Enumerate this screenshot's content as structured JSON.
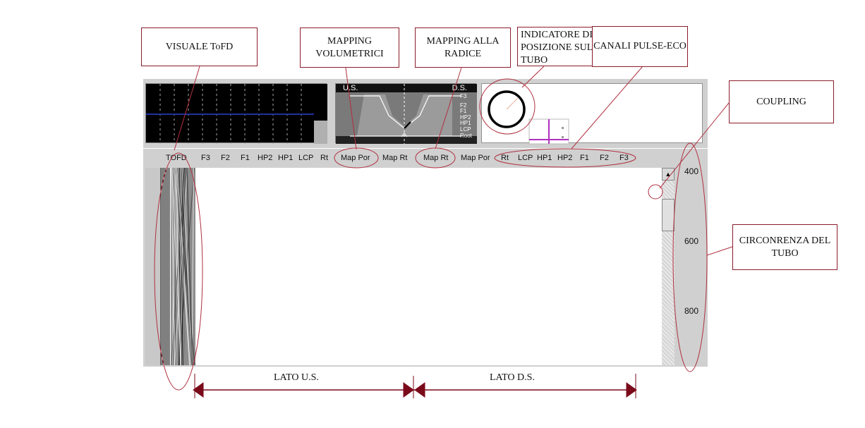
{
  "callouts": {
    "tofd_view": "VISUALE  ToFD",
    "volumetric_mapping": "MAPPING VOLUMETRICI",
    "root_mapping": "MAPPING  ALLA RADICE",
    "position_indicator": "INDICATORE DI POSIZIONE SUL TUBO",
    "pulse_echo_channels": "CANALI PULSE-ECO",
    "coupling": "COUPLING",
    "pipe_circumference": "CIRCONRENZA DEL  TUBO"
  },
  "weld_section": {
    "us_label": "U.S.",
    "ds_label": "D.S.",
    "zones": [
      "F3",
      "F2",
      "F1",
      "HP2",
      "HP1",
      "LCP",
      "Root"
    ]
  },
  "channel_headers": {
    "tofd": "TOFD",
    "us_channels": [
      "F3",
      "F2",
      "F1",
      "HP2",
      "HP1",
      "LCP",
      "Rt"
    ],
    "maps": [
      "Map Por",
      "Map Rt",
      "Map Rt",
      "Map Por"
    ],
    "ds_channels": [
      "Rt",
      "LCP",
      "HP1",
      "HP2",
      "F1",
      "F2",
      "F3"
    ]
  },
  "scale": {
    "labels": [
      "400",
      "600",
      "800"
    ]
  },
  "sides": {
    "us": "LATO  U.S.",
    "ds": "LATO  D.S."
  },
  "colors": {
    "callout_border": "#8b1c2c",
    "map_blue": "#0a1ee6",
    "cursor_magenta": "#c040c0",
    "coupling_green": "#40e040",
    "alarm_red": "#f08080"
  }
}
